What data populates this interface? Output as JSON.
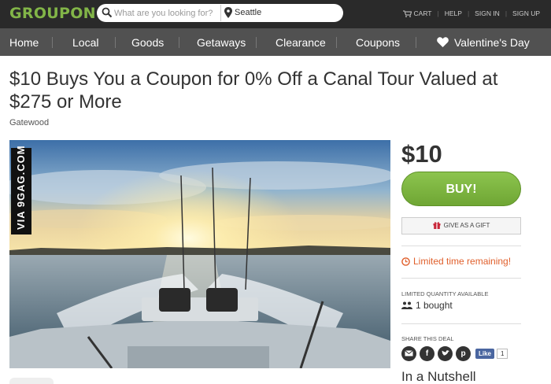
{
  "header": {
    "logo": "GROUPON",
    "search_placeholder": "What are you looking for?",
    "location": "Seattle",
    "links": [
      "CART",
      "HELP",
      "SIGN IN",
      "SIGN UP"
    ]
  },
  "nav": {
    "items": [
      "Home",
      "Local",
      "Goods",
      "Getaways",
      "Clearance",
      "Coupons",
      "Valentine's Day"
    ]
  },
  "deal": {
    "title": "$10 Buys You a Coupon for 0% Off a Canal Tour Valued at $275 or More",
    "merchant": "Gatewood",
    "price": "$10",
    "buy_label": "BUY!",
    "gift_label": "GIVE AS A GIFT",
    "limited_time": "Limited time remaining!",
    "quantity_label": "LIMITED QUANTITY AVAILABLE",
    "bought": "1 bought",
    "share_label": "SHARE THIS DEAL",
    "fb_like": "Like",
    "fb_count": "1",
    "nutshell": "In a Nutshell"
  },
  "watermark": "VIA 9GAG.COM",
  "colors": {
    "brand_green": "#82b548",
    "buy_green": "#7db642",
    "alert_orange": "#e05f2b",
    "header_bg": "#2a2a2a",
    "nav_bg": "#515151"
  },
  "icons": {
    "search": "magnifier-icon",
    "location": "pin-icon",
    "cart": "cart-icon",
    "valentine": "heart-icon",
    "gift": "gift-icon",
    "clock": "clock-icon",
    "people": "people-icon",
    "share": [
      "email-icon",
      "facebook-icon",
      "twitter-icon",
      "pinterest-icon"
    ]
  }
}
